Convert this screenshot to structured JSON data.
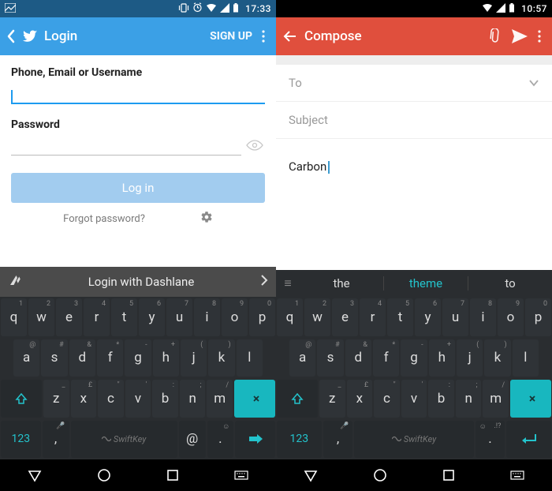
{
  "left": {
    "status": {
      "time": "17:33"
    },
    "appbar": {
      "title": "Login",
      "signup": "SIGN UP"
    },
    "form": {
      "id_label": "Phone, Email or Username",
      "id_value": "",
      "pw_label": "Password",
      "pw_value": ""
    },
    "login_btn": "Log in",
    "forgot": "Forgot password?",
    "dashlane": {
      "text": "Login with Dashlane"
    },
    "kbd": {
      "row1": [
        {
          "k": "q",
          "s": "1"
        },
        {
          "k": "w",
          "s": "2"
        },
        {
          "k": "e",
          "s": "3"
        },
        {
          "k": "r",
          "s": "4"
        },
        {
          "k": "t",
          "s": "5"
        },
        {
          "k": "y",
          "s": "6"
        },
        {
          "k": "u",
          "s": "7"
        },
        {
          "k": "i",
          "s": "8"
        },
        {
          "k": "o",
          "s": "9"
        },
        {
          "k": "p",
          "s": "0"
        }
      ],
      "row2": [
        {
          "k": "a",
          "s": "@"
        },
        {
          "k": "s",
          "s": "#"
        },
        {
          "k": "d",
          "s": "&"
        },
        {
          "k": "f",
          "s": "*"
        },
        {
          "k": "g",
          "s": "-"
        },
        {
          "k": "h",
          "s": "+"
        },
        {
          "k": "j",
          "s": "("
        },
        {
          "k": "k",
          "s": ")"
        },
        {
          "k": "l",
          "s": ""
        }
      ],
      "row3": [
        {
          "k": "z",
          "s": "_"
        },
        {
          "k": "x",
          "s": "£"
        },
        {
          "k": "c",
          "s": "\""
        },
        {
          "k": "v",
          "s": "'"
        },
        {
          "k": "b",
          "s": ":"
        },
        {
          "k": "n",
          "s": ";"
        },
        {
          "k": "m",
          "s": "/"
        }
      ],
      "num_label": "123",
      "space_label": "SwiftKey",
      "at": "@",
      "dot": ".",
      "comma": ","
    }
  },
  "right": {
    "status": {
      "time": "10:57"
    },
    "appbar": {
      "title": "Compose"
    },
    "fields": {
      "to": "To",
      "subject": "Subject"
    },
    "body_text": "Carbon",
    "suggestions": {
      "a": "the",
      "b": "theme",
      "c": "to"
    },
    "kbd": {
      "row1": [
        {
          "k": "q",
          "s": "1"
        },
        {
          "k": "w",
          "s": "2"
        },
        {
          "k": "e",
          "s": "3"
        },
        {
          "k": "r",
          "s": "4"
        },
        {
          "k": "t",
          "s": "5"
        },
        {
          "k": "y",
          "s": "6"
        },
        {
          "k": "u",
          "s": "7"
        },
        {
          "k": "i",
          "s": "8"
        },
        {
          "k": "o",
          "s": "9"
        },
        {
          "k": "p",
          "s": "0"
        }
      ],
      "row2": [
        {
          "k": "a",
          "s": "@"
        },
        {
          "k": "s",
          "s": "#"
        },
        {
          "k": "d",
          "s": "&"
        },
        {
          "k": "f",
          "s": "*"
        },
        {
          "k": "g",
          "s": "-"
        },
        {
          "k": "h",
          "s": "+"
        },
        {
          "k": "j",
          "s": "("
        },
        {
          "k": "k",
          "s": ")"
        },
        {
          "k": "l",
          "s": ""
        }
      ],
      "row3": [
        {
          "k": "z",
          "s": "_"
        },
        {
          "k": "x",
          "s": "£"
        },
        {
          "k": "c",
          "s": "\""
        },
        {
          "k": "v",
          "s": "'"
        },
        {
          "k": "b",
          "s": ":"
        },
        {
          "k": "n",
          "s": ";"
        },
        {
          "k": "m",
          "s": "/"
        }
      ],
      "num_label": "123",
      "space_label": "SwiftKey",
      "dot": ".",
      "comma": ",",
      "punct": ".!?"
    }
  }
}
